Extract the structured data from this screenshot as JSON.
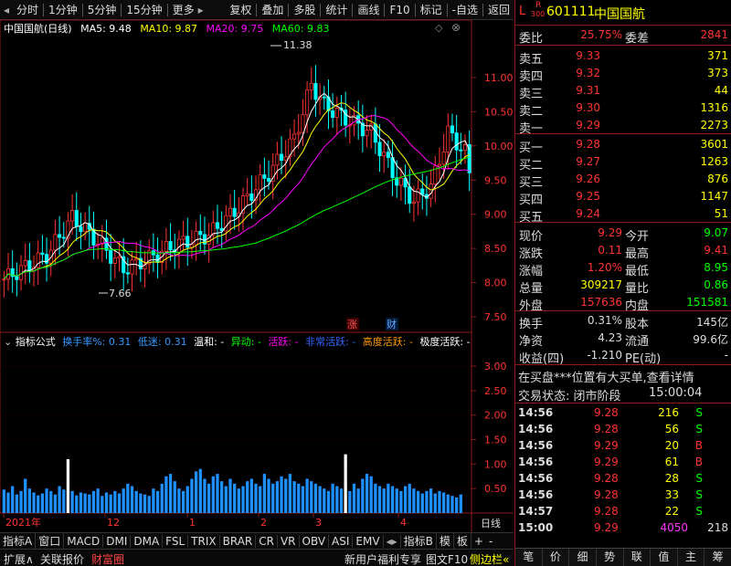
{
  "toolbar": {
    "left": [
      "分时",
      "1分钟",
      "5分钟",
      "15分钟",
      "更多"
    ],
    "right": [
      "复权",
      "叠加",
      "多股",
      "统计",
      "画线",
      "F10",
      "标记",
      "-自选",
      "返回"
    ]
  },
  "chart": {
    "title": "中国国航(日线)",
    "ma": [
      {
        "label": "MA5: 9.48",
        "color": "#ffffff"
      },
      {
        "label": "MA10: 9.87",
        "color": "#ffff00"
      },
      {
        "label": "MA20: 9.75",
        "color": "#ff00ff"
      },
      {
        "label": "MA60: 9.83",
        "color": "#00ff00"
      }
    ],
    "price_ticks": [
      "11.00",
      "10.50",
      "10.00",
      "9.50",
      "9.00",
      "8.50",
      "8.00",
      "7.50"
    ],
    "high_label": "11.38",
    "low_label": "7.66",
    "badge_zhang": "涨",
    "badge_cai": "财",
    "ind_ticks": [
      "3.00",
      "2.50",
      "2.00",
      "1.50",
      "1.00",
      "0.50"
    ],
    "date_labels": [
      "2021年",
      "12",
      "1",
      "2",
      "3",
      "4"
    ],
    "period": "日线",
    "indicator_bar": [
      {
        "text": "指标公式",
        "color": "#ffffff"
      },
      {
        "text": "换手率%: 0.31",
        "color": "#3399ff"
      },
      {
        "text": "低迷: 0.31",
        "color": "#3399ff"
      },
      {
        "text": "温和: -",
        "color": "#ffffff"
      },
      {
        "text": "异动: -",
        "color": "#00ff00"
      },
      {
        "text": "活跃: -",
        "color": "#ff00ff"
      },
      {
        "text": "非常活跃: -",
        "color": "#3366ff"
      },
      {
        "text": "高度活跃: -",
        "color": "#ff9900"
      },
      {
        "text": "极度活跃: -",
        "color": "#ffffff"
      }
    ]
  },
  "chart_data": {
    "type": "bar",
    "title": "中国国航(日线)",
    "price_range": [
      7.3,
      11.6
    ],
    "price_high": 11.38,
    "price_low": 7.66,
    "turnover_range": [
      0,
      3.3
    ],
    "turnover": [
      0.48,
      0.42,
      0.55,
      0.38,
      0.45,
      0.7,
      0.5,
      0.42,
      0.36,
      0.4,
      0.5,
      0.45,
      0.38,
      0.55,
      0.48,
      1.1,
      0.45,
      0.36,
      0.42,
      0.4,
      0.38,
      0.45,
      0.5,
      0.35,
      0.42,
      0.38,
      0.45,
      0.4,
      0.5,
      0.6,
      0.55,
      0.45,
      0.4,
      0.38,
      0.35,
      0.5,
      0.45,
      0.6,
      0.75,
      0.8,
      0.65,
      0.5,
      0.45,
      0.55,
      0.7,
      0.85,
      0.9,
      0.7,
      0.6,
      0.75,
      0.8,
      0.65,
      0.55,
      0.7,
      0.6,
      0.5,
      0.55,
      0.65,
      0.7,
      0.6,
      0.55,
      0.8,
      0.7,
      0.6,
      0.65,
      0.75,
      0.7,
      0.8,
      0.65,
      0.6,
      0.55,
      0.7,
      0.65,
      0.6,
      0.55,
      0.5,
      0.45,
      0.6,
      0.55,
      0.5,
      1.2,
      0.45,
      0.6,
      0.5,
      0.7,
      0.8,
      0.75,
      0.6,
      0.55,
      0.5,
      0.6,
      0.55,
      0.5,
      0.45,
      0.55,
      0.6,
      0.5,
      0.45,
      0.4,
      0.45,
      0.5,
      0.4,
      0.45,
      0.42,
      0.38,
      0.35,
      0.32,
      0.38
    ],
    "turnover_white_at": [
      15,
      80
    ]
  },
  "quote": {
    "code": "601111",
    "name": "中国国航",
    "r300": "R",
    "r300_sub": "300",
    "l_mark": "L",
    "weibi_label": "委比",
    "weibi": "25.75%",
    "weicha_label": "委差",
    "weicha": "2841",
    "asks": [
      {
        "label": "卖五",
        "price": "9.33",
        "vol": "371"
      },
      {
        "label": "卖四",
        "price": "9.32",
        "vol": "373"
      },
      {
        "label": "卖三",
        "price": "9.31",
        "vol": "44"
      },
      {
        "label": "卖二",
        "price": "9.30",
        "vol": "1316"
      },
      {
        "label": "卖一",
        "price": "9.29",
        "vol": "2273"
      }
    ],
    "bids": [
      {
        "label": "买一",
        "price": "9.28",
        "vol": "3601"
      },
      {
        "label": "买二",
        "price": "9.27",
        "vol": "1263"
      },
      {
        "label": "买三",
        "price": "9.26",
        "vol": "876"
      },
      {
        "label": "买四",
        "price": "9.25",
        "vol": "1147"
      },
      {
        "label": "买五",
        "price": "9.24",
        "vol": "51"
      }
    ],
    "stats": [
      {
        "l1": "现价",
        "v1": "9.29",
        "c1": "#ff3333",
        "l2": "今开",
        "v2": "9.07",
        "c2": "#00ff00"
      },
      {
        "l1": "涨跌",
        "v1": "0.11",
        "c1": "#ff3333",
        "l2": "最高",
        "v2": "9.41",
        "c2": "#ff3333"
      },
      {
        "l1": "涨幅",
        "v1": "1.20%",
        "c1": "#ff3333",
        "l2": "最低",
        "v2": "8.95",
        "c2": "#00ff00"
      },
      {
        "l1": "总量",
        "v1": "309217",
        "c1": "#ffff00",
        "l2": "量比",
        "v2": "0.86",
        "c2": "#00ff00"
      },
      {
        "l1": "外盘",
        "v1": "157636",
        "c1": "#ff3333",
        "l2": "内盘",
        "v2": "151581",
        "c2": "#00ff00"
      }
    ],
    "stats2": [
      {
        "l1": "换手",
        "v1": "0.31%",
        "l2": "股本",
        "v2": "145亿"
      },
      {
        "l1": "净资",
        "v1": "4.23",
        "l2": "流通",
        "v2": "99.6亿"
      },
      {
        "l1": "收益(四)",
        "v1": "-1.210",
        "l2": "PE(动)",
        "v2": "-"
      }
    ],
    "notice": "在买盘***位置有大买单,查看详情",
    "status_label": "交易状态: 闭市阶段",
    "status_time": "15:00:04",
    "ticks": [
      {
        "t": "14:56",
        "p": "9.28",
        "v": "216",
        "f": "S"
      },
      {
        "t": "14:56",
        "p": "9.28",
        "v": "56",
        "f": "S"
      },
      {
        "t": "14:56",
        "p": "9.29",
        "v": "20",
        "f": "B"
      },
      {
        "t": "14:56",
        "p": "9.29",
        "v": "61",
        "f": "B"
      },
      {
        "t": "14:56",
        "p": "9.28",
        "v": "28",
        "f": "S"
      },
      {
        "t": "14:56",
        "p": "9.28",
        "v": "33",
        "f": "S"
      },
      {
        "t": "14:57",
        "p": "9.28",
        "v": "22",
        "f": "S"
      },
      {
        "t": "15:00",
        "p": "9.29",
        "v": "4050",
        "f": "218"
      }
    ],
    "tabs": [
      "笔",
      "价",
      "细",
      "势",
      "联",
      "值",
      "主",
      "筹"
    ]
  },
  "bottom": {
    "row1": [
      "指标A",
      "窗口",
      "MACD",
      "DMI",
      "DMA",
      "FSL",
      "TRIX",
      "BRAR",
      "CR",
      "VR",
      "OBV",
      "ASI",
      "EMV",
      "指标B",
      "模",
      "板"
    ],
    "plus": "+",
    "minus": "-",
    "row2": [
      "扩展∧",
      "关联报价",
      "财富圈"
    ],
    "promo": "新用户福利专享",
    "tuwen": "图文F10",
    "side": "侧边栏«"
  }
}
